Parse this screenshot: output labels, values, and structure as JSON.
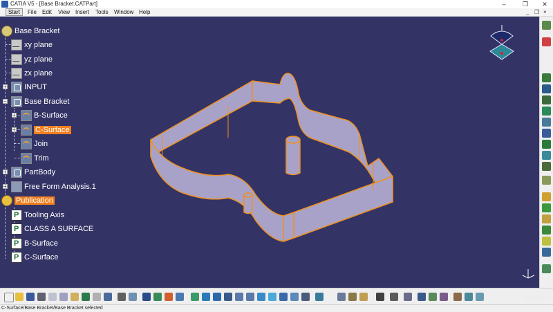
{
  "window": {
    "title": "CATIA V5 - [Base Bracket.CATPart]",
    "minimize": "–",
    "restore": "❐",
    "close": "✕"
  },
  "menubar": {
    "items": [
      "Start",
      "File",
      "Edit",
      "View",
      "Insert",
      "Tools",
      "Window",
      "Help"
    ],
    "doc_controls": [
      "_",
      "❐",
      "×"
    ]
  },
  "tree": {
    "root": "Base Bracket",
    "xy_plane": "xy plane",
    "yz_plane": "yz plane",
    "zx_plane": "zx plane",
    "input": "INPUT",
    "base_bracket_set": "Base Bracket",
    "b_surface": "B-Surface",
    "c_surface": "C-Surface",
    "join": "Join",
    "trim": "Trim",
    "partbody": "PartBody",
    "ffa": "Free Form Analysis.1",
    "publication": "Publication",
    "pub_items": [
      "Tooling Axis",
      "CLASS A SURFACE",
      "B-Surface",
      "C-Surface"
    ]
  },
  "colors": {
    "viewport_bg": "#333366",
    "highlight": "#f08020",
    "surface_fill": "#a9a2c8",
    "surface_edge": "#f0901c"
  },
  "status": {
    "text": "C-Surface/Base Bracket/Base Bracket selected"
  }
}
